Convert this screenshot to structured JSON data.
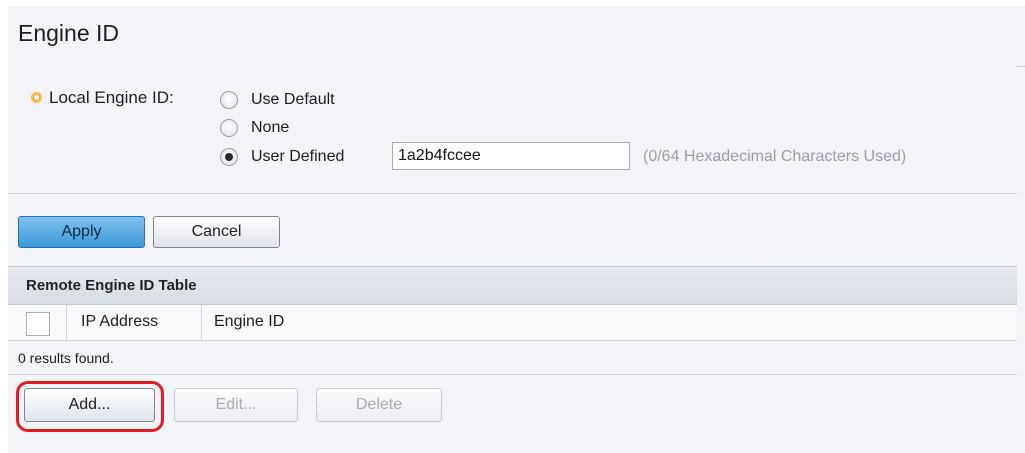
{
  "page": {
    "title": "Engine ID"
  },
  "local_engine": {
    "label": "Local Engine ID:",
    "options": [
      {
        "label": "Use Default",
        "checked": false
      },
      {
        "label": "None",
        "checked": false
      },
      {
        "label": "User Defined",
        "checked": true
      }
    ],
    "input_value": "1a2b4fccee",
    "hint": "(0/64 Hexadecimal Characters Used)"
  },
  "form_actions": {
    "apply_label": "Apply",
    "cancel_label": "Cancel"
  },
  "remote_table": {
    "caption": "Remote Engine ID Table",
    "columns": [
      "IP Address",
      "Engine ID"
    ],
    "results_text": "0 results found.",
    "add_label": "Add...",
    "edit_label": "Edit...",
    "delete_label": "Delete"
  },
  "colors": {
    "primary_button": "#3b97d8",
    "required_icon": "#f3a21f",
    "highlight": "#e31c24"
  }
}
